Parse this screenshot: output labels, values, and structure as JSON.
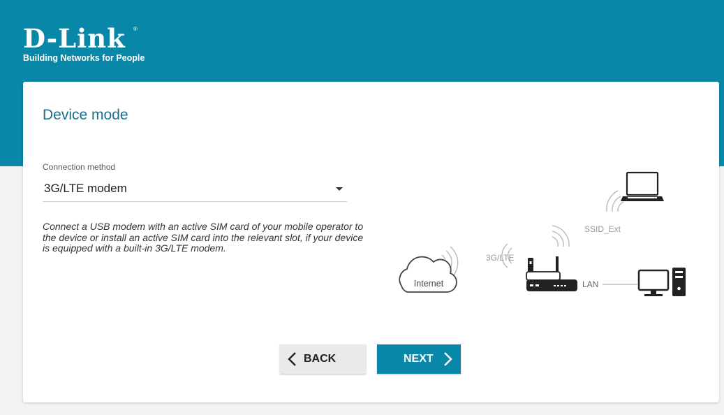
{
  "brand": {
    "name": "D-Link",
    "registered": "®",
    "tagline": "Building Networks for People"
  },
  "page": {
    "title": "Device mode"
  },
  "connection_method": {
    "label": "Connection method",
    "selected": "3G/LTE modem",
    "description": "Connect a USB modem with an active SIM card of your mobile operator to the device or install an active SIM card into the relevant slot, if your device is equipped with a built-in 3G/LTE modem."
  },
  "diagram": {
    "internet_label": "Internet",
    "mobile_label": "3G/LTE",
    "wifi_label": "SSID_Ext",
    "lan_label": "LAN"
  },
  "buttons": {
    "back": "BACK",
    "next": "NEXT"
  },
  "colors": {
    "brand_blue": "#0987a8",
    "title_blue": "#1d6e8b"
  }
}
